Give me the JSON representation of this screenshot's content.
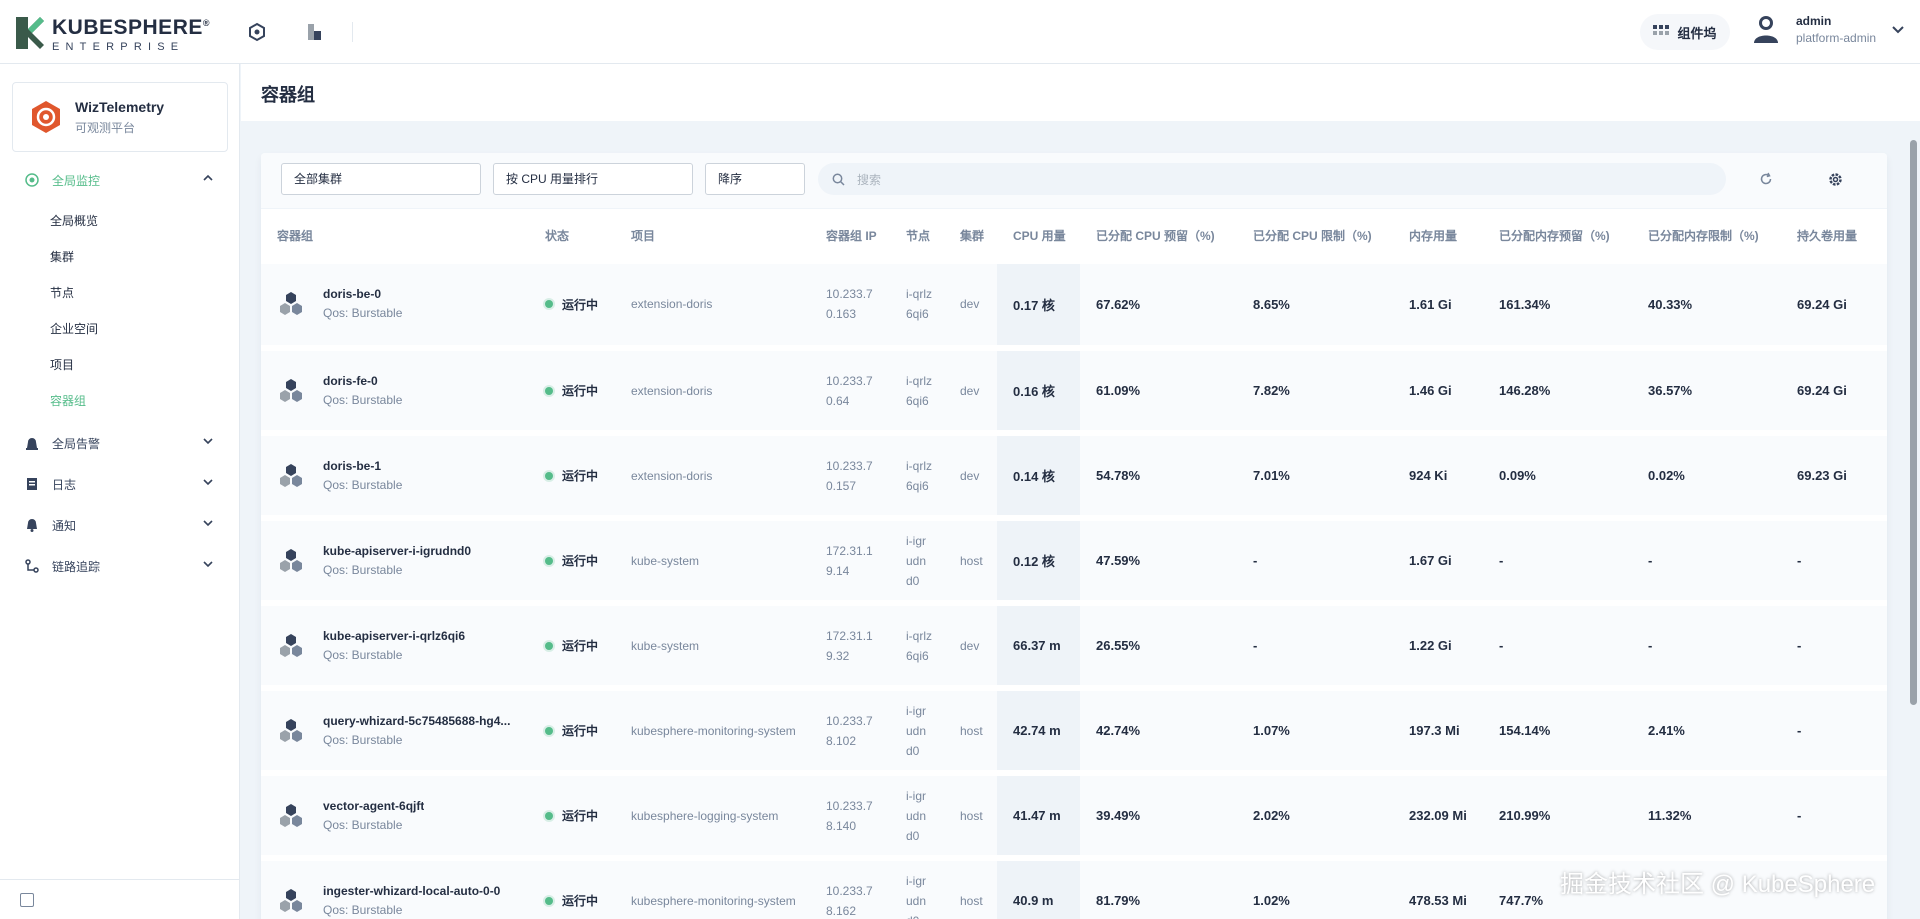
{
  "header": {
    "brand": "KUBESPHERE",
    "brand_sub": "ENTERPRISE",
    "workbench_label": "组件坞",
    "user_name": "admin",
    "user_role": "platform-admin"
  },
  "sidebar": {
    "app_name": "WizTelemetry",
    "app_desc": "可观测平台",
    "groups": [
      {
        "label": "全局监控"
      },
      {
        "label": "全局告警"
      },
      {
        "label": "日志"
      },
      {
        "label": "通知"
      },
      {
        "label": "链路追踪"
      }
    ],
    "monitoring_items": [
      "全局概览",
      "集群",
      "节点",
      "企业空间",
      "项目",
      "容器组"
    ]
  },
  "page": {
    "title": "容器组"
  },
  "toolbar": {
    "cluster_select": "全部集群",
    "sort_select": "按 CPU 用量排行",
    "order_select": "降序",
    "search_placeholder": "搜索"
  },
  "table": {
    "headers": [
      "容器组",
      "状态",
      "项目",
      "容器组 IP",
      "节点",
      "集群",
      "CPU 用量",
      "已分配 CPU 预留（%)",
      "已分配 CPU 限制（%)",
      "内存用量",
      "已分配内存预留（%)",
      "已分配内存限制（%)",
      "持久卷用量"
    ],
    "rows": [
      {
        "name": "doris-be-0",
        "qos": "Qos: Burstable",
        "status": "运行中",
        "project": "extension-doris",
        "ip": "10.233.70.163",
        "node": "i-qrlz6qi6",
        "cluster": "dev",
        "cpu": "0.17 核",
        "cpu_req": "67.62%",
        "cpu_lim": "8.65%",
        "mem": "1.61 Gi",
        "mem_req": "161.34%",
        "mem_lim": "40.33%",
        "pv": "69.24 Gi"
      },
      {
        "name": "doris-fe-0",
        "qos": "Qos: Burstable",
        "status": "运行中",
        "project": "extension-doris",
        "ip": "10.233.70.64",
        "node": "i-qrlz6qi6",
        "cluster": "dev",
        "cpu": "0.16 核",
        "cpu_req": "61.09%",
        "cpu_lim": "7.82%",
        "mem": "1.46 Gi",
        "mem_req": "146.28%",
        "mem_lim": "36.57%",
        "pv": "69.24 Gi"
      },
      {
        "name": "doris-be-1",
        "qos": "Qos: Burstable",
        "status": "运行中",
        "project": "extension-doris",
        "ip": "10.233.70.157",
        "node": "i-qrlz6qi6",
        "cluster": "dev",
        "cpu": "0.14 核",
        "cpu_req": "54.78%",
        "cpu_lim": "7.01%",
        "mem": "924 Ki",
        "mem_req": "0.09%",
        "mem_lim": "0.02%",
        "pv": "69.23 Gi"
      },
      {
        "name": "kube-apiserver-i-igrudnd0",
        "qos": "Qos: Burstable",
        "status": "运行中",
        "project": "kube-system",
        "ip": "172.31.19.14",
        "node": "i-igrudnd0",
        "cluster": "host",
        "cpu": "0.12 核",
        "cpu_req": "47.59%",
        "cpu_lim": "-",
        "mem": "1.67 Gi",
        "mem_req": "-",
        "mem_lim": "-",
        "pv": "-"
      },
      {
        "name": "kube-apiserver-i-qrlz6qi6",
        "qos": "Qos: Burstable",
        "status": "运行中",
        "project": "kube-system",
        "ip": "172.31.19.32",
        "node": "i-qrlz6qi6",
        "cluster": "dev",
        "cpu": "66.37 m",
        "cpu_req": "26.55%",
        "cpu_lim": "-",
        "mem": "1.22 Gi",
        "mem_req": "-",
        "mem_lim": "-",
        "pv": "-"
      },
      {
        "name": "query-whizard-5c75485688-hg4...",
        "qos": "Qos: Burstable",
        "status": "运行中",
        "project": "kubesphere-monitoring-system",
        "ip": "10.233.78.102",
        "node": "i-igrudnd0",
        "cluster": "host",
        "cpu": "42.74 m",
        "cpu_req": "42.74%",
        "cpu_lim": "1.07%",
        "mem": "197.3 Mi",
        "mem_req": "154.14%",
        "mem_lim": "2.41%",
        "pv": "-"
      },
      {
        "name": "vector-agent-6qjft",
        "qos": "Qos: Burstable",
        "status": "运行中",
        "project": "kubesphere-logging-system",
        "ip": "10.233.78.140",
        "node": "i-igrudnd0",
        "cluster": "host",
        "cpu": "41.47 m",
        "cpu_req": "39.49%",
        "cpu_lim": "2.02%",
        "mem": "232.09 Mi",
        "mem_req": "210.99%",
        "mem_lim": "11.32%",
        "pv": "-"
      },
      {
        "name": "ingester-whizard-local-auto-0-0",
        "qos": "Qos: Burstable",
        "status": "运行中",
        "project": "kubesphere-monitoring-system",
        "ip": "10.233.78.162",
        "node": "i-igrudnd0",
        "cluster": "host",
        "cpu": "40.9 m",
        "cpu_req": "81.79%",
        "cpu_lim": "1.02%",
        "mem": "478.53 Mi",
        "mem_req": "747.7%",
        "mem_lim": "",
        "pv": ""
      }
    ]
  },
  "watermark": "掘金技术社区 @ KubeSphere"
}
